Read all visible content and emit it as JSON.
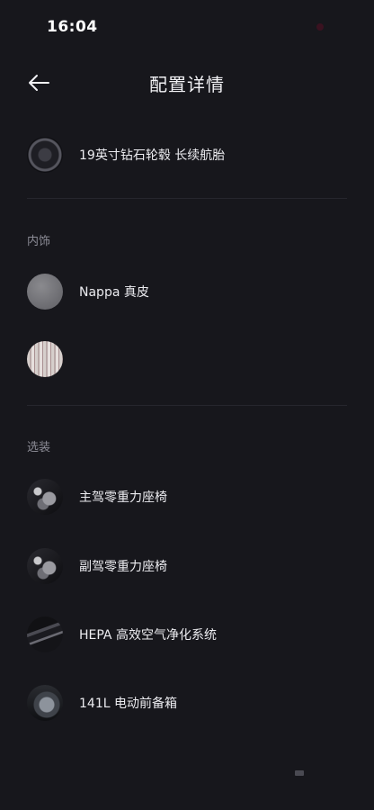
{
  "status_bar": {
    "time": "16:04"
  },
  "header": {
    "title": "配置详情",
    "back_icon": "arrow-left-icon"
  },
  "items": {
    "wheel": {
      "label": "19英寸钻石轮毂 长续航胎",
      "icon": "wheel-thumbnail"
    },
    "interior_nappa": {
      "label": "Nappa 真皮",
      "icon": "leather-swatch"
    },
    "interior_trim": {
      "label": "",
      "icon": "trim-swatch"
    }
  },
  "sections": {
    "interior": {
      "title": "内饰"
    },
    "options": {
      "title": "选装"
    }
  },
  "options": [
    {
      "label": "主驾零重力座椅",
      "icon": "seat-thumbnail"
    },
    {
      "label": "副驾零重力座椅",
      "icon": "seat-thumbnail"
    },
    {
      "label": "HEPA 高效空气净化系统",
      "icon": "air-filter-thumbnail"
    },
    {
      "label": "141L 电动前备箱",
      "icon": "car-thumbnail"
    }
  ],
  "colors": {
    "background": "#17171c",
    "text": "#ececf0",
    "muted": "#8c8c96",
    "divider": "#26262d"
  }
}
